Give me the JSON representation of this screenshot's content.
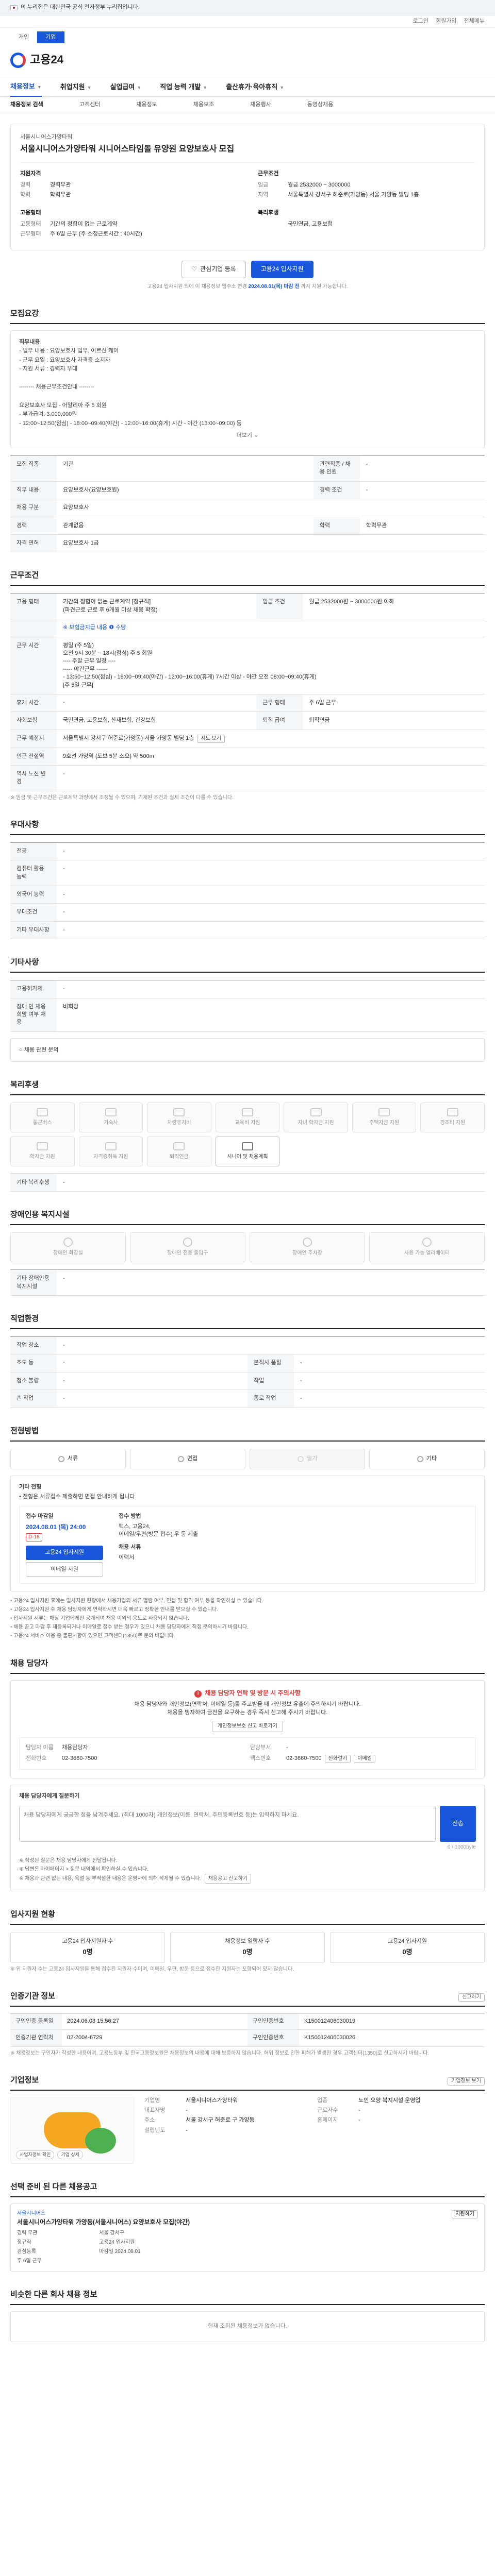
{
  "gov_banner": "이 누리집은 대한민국 공식 전자정부 누리집입니다.",
  "top_links": [
    "로그인",
    "회원가입",
    "전체메뉴"
  ],
  "portal_tabs": [
    "개인",
    "기업"
  ],
  "logo": "고용24",
  "gnb": [
    "채용정보",
    "취업지원",
    "실업급여",
    "직업 능력 개발",
    "출산휴가·육아휴직"
  ],
  "subnav": [
    "채용정보 검색",
    "고객센터",
    "채용정보",
    "채용보조",
    "채용행사",
    "동영상채용"
  ],
  "job": {
    "company": "서울시니어스가양타워",
    "title": "서울시니어스가양타워 시니어스타임돌 유양원 요양보호사 모집",
    "req_head": "지원자격",
    "req": [
      {
        "k": "경력",
        "v": "경력무관"
      },
      {
        "k": "학력",
        "v": "학력무관"
      }
    ],
    "cond_head": "근무조건",
    "cond": [
      {
        "k": "임금",
        "v": "월급 2532000 ~ 3000000"
      },
      {
        "k": "지역",
        "v": "서울특별시 강서구 허준로(가양동) 서울 가양동 빌딩 1층"
      }
    ],
    "emp_head": "고용형태",
    "emp": [
      {
        "k": "고용형태",
        "v": "기간의 정함이 없는 근로계약"
      },
      {
        "k": "근무형태",
        "v": "주 6일 근무 (주 소정근로시간 : 40시간)"
      }
    ],
    "welfare_head": "복리후생",
    "welfare": [
      {
        "k": "",
        "v": "국민연금, 고용보험"
      }
    ],
    "btn_interest": "관심기업 등록",
    "btn_apply": "고용24 입사지원",
    "apply_note": "고용24 입사지원 외에 이 채용정보 웹주소 변경",
    "apply_note_link": "2024.08.01(목) 마감 전",
    "apply_note_tail": "까지 지원 가능합니다."
  },
  "sections": {
    "recruit": "모집요강",
    "work_cond": "근무조건",
    "selection": "우대사항",
    "process": "기타사항",
    "welfare": "복리후생",
    "disabled": "장애인용 복지시설",
    "hr": "직업환경",
    "method": "전형방법",
    "manager": "채용 담당자",
    "apply_status": "입사지원 현황",
    "info": "인증기관 정보",
    "corp": "기업정보",
    "other": "선택 준비 된 다른 채용공고",
    "similar": "비슷한 다른 회사 채용 정보"
  },
  "recruit": {
    "desc_title": "직무내용",
    "desc": "- 업무 내용 : 요양보호사 업무, 어르신 케어\n- 근무 요일 : 요양보호사 자격증 소지자\n- 지원 서류 : 경력자 우대\n\n-------- 채용근무조건안내 --------\n\n요양보호사 모집 - 어말리아 주 5 회원\n- 부가급여: 3,000,000원\n- 12:00~12:50(점심) - 18:00~09:40(야간) - 12:00~16:00(휴게) 시간 - 야간 (13:00~09:00) 등",
    "more": "더보기",
    "rows": [
      {
        "k": "모집 직종",
        "v": "기관",
        "k2": "관련직종 / 채용 인원",
        "v2": "-"
      },
      {
        "k": "직무 내용",
        "v": "요양보호사(요양보호원)",
        "k2": "경력 조건",
        "v2": "-"
      },
      {
        "k": "채용 구분",
        "v": "요양보호사",
        "k2": "",
        "v2": ""
      },
      {
        "k": "경력",
        "v": "관계없음",
        "k2": "학력",
        "v2": "학력무관"
      },
      {
        "k": "자격 면허",
        "v": "요양보호사 1급",
        "k2": "",
        "v2": ""
      }
    ]
  },
  "work": {
    "rows": [
      {
        "k": "고용 형태",
        "v": "기간의 정함이 없는 근로계약 [정규직]\n(파견근로 근로 후 6개월 이상 채용 확정)",
        "k2": "임금 조건",
        "v2": "월급 2532000원 ~ 3000000원 이하"
      },
      {
        "k": "",
        "v": "※ 보험금지급 내용 ❶ 수당",
        "k2": "",
        "v2": ""
      },
      {
        "k": "근무 시간",
        "v": "평일 (주 5일)\n오전 9시 30분 ~ 18시(점심) 주 5 회원\n---- 주말 근무 일정 ----\n----- 야간근무 ------\n- 13:50~12:50(점심) - 19:00~09:40(야간) - 12:00~16:00(휴게) 7시간 이상 - 야간 오전 08:00~09:40(휴게)\n[주 5일 근무]",
        "k2": "",
        "v2": ""
      },
      {
        "k": "휴게 시간",
        "v": "-",
        "k2": "근무 형태",
        "v2": "주 6일 근무"
      },
      {
        "k": "사회보험",
        "v": "국민연금, 고용보험, 산재보험, 건강보험",
        "k2": "퇴직 급여",
        "v2": "퇴직연금"
      },
      {
        "k": "근무 예정지",
        "v": "서울특별시 강서구 허준로(가양동) 서울 가양동 빌딩 1층",
        "k2": "",
        "v2": ""
      },
      {
        "k": "인근 전철역",
        "v": "9호선 가양역 (도보 5분 소요) 약 500m",
        "k2": "",
        "v2": ""
      },
      {
        "k": "역사 노선 변경",
        "v": "-",
        "k2": "",
        "v2": ""
      }
    ],
    "footnote": "※ 임금 및 근무조건은 근로계약 과정에서 조정될 수 있으며, 기재된 조건과 실제 조건이 다를 수 있습니다."
  },
  "prefer": {
    "rows": [
      {
        "k": "전공",
        "v": "-"
      },
      {
        "k": "컴퓨터 활용 능력",
        "v": "-"
      },
      {
        "k": "외국어 능력",
        "v": "-"
      },
      {
        "k": "우대조건",
        "v": "-"
      },
      {
        "k": "기타 우대사항",
        "v": "-"
      }
    ]
  },
  "etc": {
    "rows": [
      {
        "k": "고용허가제",
        "v": "-"
      },
      {
        "k": "장애 인 채용 희망 여부 채용",
        "v": "비희망"
      }
    ],
    "contact": "○ 채용 관련 문의"
  },
  "welfare": {
    "items": [
      "통근버스",
      "기숙사",
      "차량유지비",
      "교육비 지원",
      "자녀 학자금 지원",
      "주택자금 지원",
      "경조비 지원",
      "학자금 지원",
      "자격증취득 지원",
      "퇴직연금",
      "시니어 및 채용계획"
    ],
    "active": [
      10
    ],
    "other_label": "기타 복리후생",
    "other_value": "-"
  },
  "disabled": {
    "items": [
      "장애인 화장실",
      "장애인 전용 출입구",
      "장애인 주차장",
      "사용 가능 엘리베이터"
    ],
    "other_label": "기타 장애인용 복지시설",
    "other_value": "-"
  },
  "env": {
    "rows": [
      {
        "k": "작업 장소",
        "v": "-",
        "k2": "",
        "v2": ""
      },
      {
        "k": "조도 등",
        "v": "-",
        "k2": "본직사 품질",
        "v2": "-"
      },
      {
        "k": "청소 불량",
        "v": "-",
        "k2": "작업",
        "v2": "-"
      },
      {
        "k": "손 작업",
        "v": "-",
        "k2": "통로 작업",
        "v2": "-"
      }
    ]
  },
  "method": {
    "items": [
      "서류",
      "면접",
      "필기",
      "기타"
    ],
    "active": [
      0,
      1,
      3
    ],
    "head": "기타 전형",
    "head_val": "• 전형은 서류접수 제출하면 면접 안내하게 됩니다.",
    "recv_title": "접수 마감일",
    "recv_date": "2024.08.01 (목) 24:00",
    "recv_dday": "D-18",
    "recv_btn": "고용24 입사지원",
    "recv_btn2": "이메일 지원",
    "doc_title": "접수 방법",
    "doc_val": "팩스, 고용24, \n이메일/우편(방문 접수) 우 등 제출",
    "doc_sub": "채용 서류",
    "doc_sub_val": "이력서",
    "notes": [
      "고용24 입사지원 후에는 입사지원 현황에서 채용기업의 서류 열람 여부, 면접 및 합격 여부 등을 확인하실 수 있습니다.",
      "고용24 입사지원 후 채용 담당자에게 연락하시면 더욱 빠르고 정확한 안내를 받으실 수 있습니다.",
      "입사지원 서류는 해당 기업에게만 공개되며 채용 이외의 용도로 사용되지 않습니다.",
      "채용 공고 마감 후 재등록되거나 이메일로 접수 받는 경우가 있으니 채용 담당자에게 직접 문의하시기 바랍니다.",
      "고용24 서비스 이용 중 불편사항이 있으면 고객센터(1350)로 문의 바랍니다."
    ]
  },
  "manager": {
    "warn_title": "채용 담당자 연락 및 방문 시 주의사항",
    "warn_text": "채용 담당자와 개인정보(연락처, 이메일 등)를 주고받을 때 개인정보 유출에 주의하시기 바랍니다.\n채용을 빙자하여 금전을 요구하는 경우 즉시 신고해 주시기 바랍니다.",
    "warn_btn": "개인정보보호 신고 바로가기",
    "name_k": "담당자 이름",
    "name_v": "채용담당자",
    "dept_k": "담당부서",
    "dept_v": "-",
    "tel_k": "전화번호",
    "tel_v": "02-3660-7500",
    "fax_k": "팩스번호",
    "fax_v": "02-3660-7500",
    "email_k": "이메일",
    "email_v": "-",
    "btn_call": "전화걸기",
    "btn_email": "이메일"
  },
  "question": {
    "title": "채용 담당자에게 질문하기",
    "placeholder": "채용 담당자에게 궁금한 점을 남겨주세요. (최대 1000자) 개인정보(이름, 연락처, 주민등록번호 등)는 입력하지 마세요.",
    "count": "0 / 1000byte",
    "btn": "전송",
    "notes": [
      "※ 작성된 질문은 채용 담당자에게 전달됩니다.",
      "※ 답변은 마이페이지 > 질문 내역에서 확인하실 수 있습니다.",
      "※ 채용과 관련 없는 내용, 욕설 등 부적절한 내용은 운영자에 의해 삭제될 수 있습니다."
    ],
    "notes_btn": "채용공고 신고하기"
  },
  "apply_status": {
    "items": [
      {
        "label": "고용24 입사지원자 수",
        "val": "0명"
      },
      {
        "label": "채용정보 열람자 수",
        "val": "0명"
      },
      {
        "label": "고용24 입사지원",
        "val": "0명"
      }
    ],
    "note": "※ 위 지원자 수는 고용24 입사지원을 통해 접수된 지원자 수이며, 이메일, 우편, 방문 등으로 접수한 지원자는 포함되어 있지 않습니다."
  },
  "info": {
    "title_right": "신고하기",
    "rows": [
      {
        "k": "구인인증 등록일",
        "v": "2024.06.03 15:56:27",
        "k2": "구인인증번호",
        "v2": "K150012406030019"
      },
      {
        "k": "인증기관 연락처",
        "v": "02-2004-6729",
        "k2": "구인인증번호",
        "v2": "K150012406030026"
      }
    ],
    "note": "※ 채용정보는 구인자가 작성한 내용이며, 고용노동부 및 한국고용정보원은 채용정보의 내용에 대해 보증하지 않습니다. 허위 정보로 인한 피해가 발생한 경우 고객센터(1350)로 신고하시기 바랍니다."
  },
  "corp": {
    "title_right": "기업정보 보기",
    "tags": [
      "사업자정보 확인",
      "기업 상세"
    ],
    "rows": [
      {
        "k": "기업명",
        "v": "서울시니어스가양타워",
        "k2": "업종",
        "v2": "노인 요양 복지시설 운영업"
      },
      {
        "k": "대표자명",
        "v": "-",
        "k2": "근로자수",
        "v2": "-"
      },
      {
        "k": "주소",
        "v": "서울 강서구 허준로 구 가양동",
        "k2": "홈페이지",
        "v2": "-"
      },
      {
        "k": "설립년도",
        "v": "-",
        "k2": "",
        "v2": ""
      }
    ]
  },
  "other": {
    "company": "서울시니어스",
    "title": "서울시니어스가양타워 가양동(서울시니어스) 요양보호사 모집(야간)",
    "meta": [
      "경력 무관",
      "서울 강서구",
      "정규직",
      "고용24 입사지원",
      "관심등록",
      "마감일 2024.08.01",
      "주 6일 근무"
    ],
    "right": "지원하기"
  },
  "similar": {
    "empty": "현재 조회된 채용정보가 없습니다."
  }
}
